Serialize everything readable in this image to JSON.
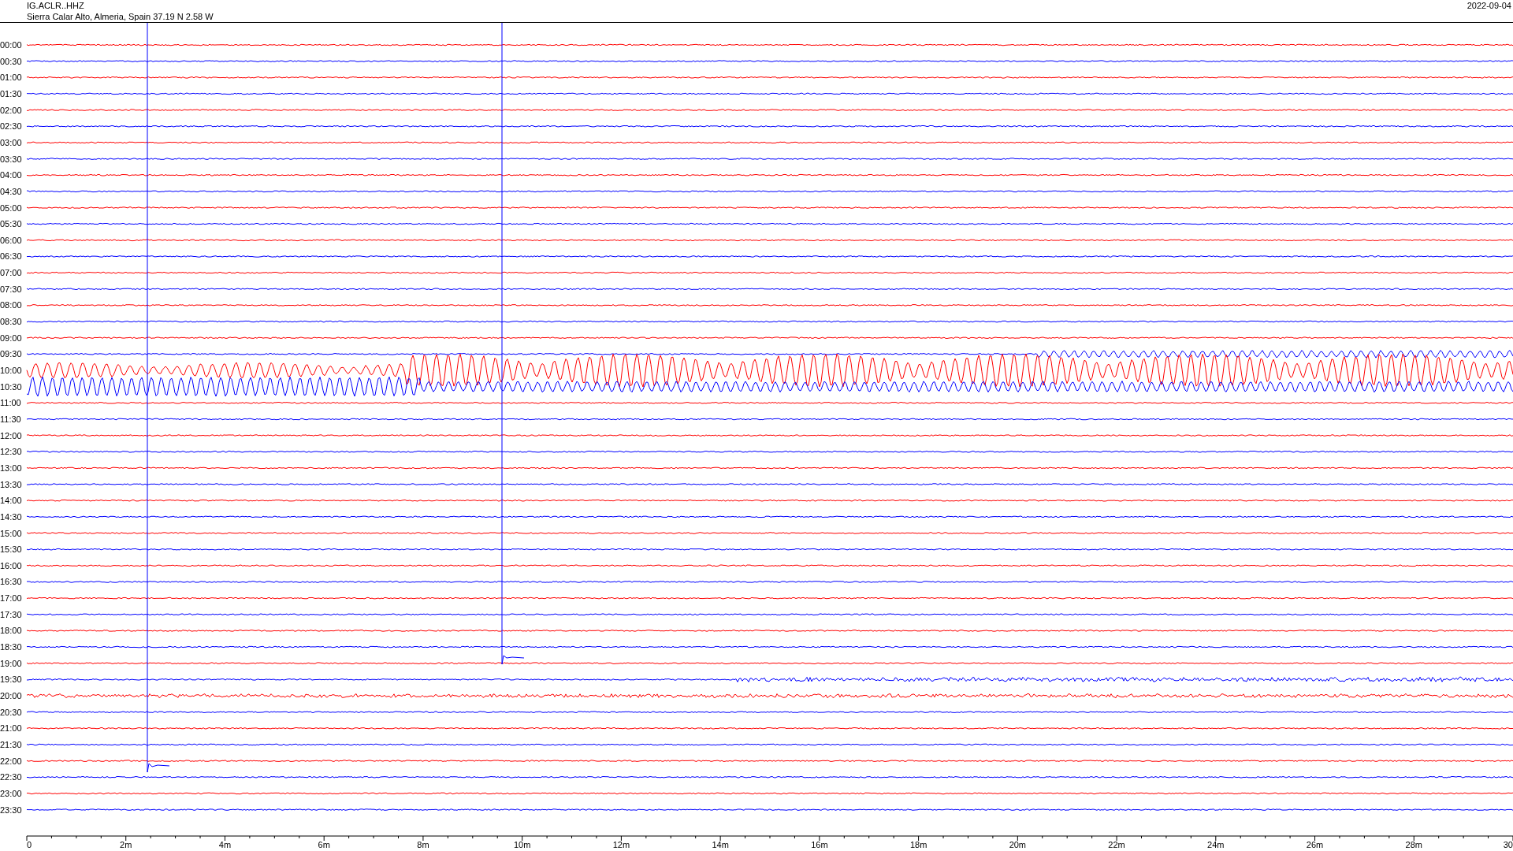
{
  "header": {
    "station": "IG.ACLR..HHZ",
    "location": "Sierra Calar Alto, Almeria, Spain  37.19 N 2.58 W",
    "date": "2022-09-04"
  },
  "rows": [
    {
      "label": "00:00",
      "color": "#ff0000"
    },
    {
      "label": "00:30",
      "color": "#0000ff"
    },
    {
      "label": "01:00",
      "color": "#ff0000"
    },
    {
      "label": "01:30",
      "color": "#0000ff"
    },
    {
      "label": "02:00",
      "color": "#ff0000"
    },
    {
      "label": "02:30",
      "color": "#0000ff"
    },
    {
      "label": "03:00",
      "color": "#ff0000"
    },
    {
      "label": "03:30",
      "color": "#0000ff"
    },
    {
      "label": "04:00",
      "color": "#ff0000"
    },
    {
      "label": "04:30",
      "color": "#0000ff"
    },
    {
      "label": "05:00",
      "color": "#ff0000"
    },
    {
      "label": "05:30",
      "color": "#0000ff"
    },
    {
      "label": "06:00",
      "color": "#ff0000"
    },
    {
      "label": "06:30",
      "color": "#0000ff"
    },
    {
      "label": "07:00",
      "color": "#ff0000"
    },
    {
      "label": "07:30",
      "color": "#0000ff"
    },
    {
      "label": "08:00",
      "color": "#ff0000"
    },
    {
      "label": "08:30",
      "color": "#0000ff"
    },
    {
      "label": "09:00",
      "color": "#ff0000"
    },
    {
      "label": "09:30",
      "color": "#0000ff"
    },
    {
      "label": "10:00",
      "color": "#ff0000"
    },
    {
      "label": "10:30",
      "color": "#0000ff"
    },
    {
      "label": "11:00",
      "color": "#ff0000"
    },
    {
      "label": "11:30",
      "color": "#0000ff"
    },
    {
      "label": "12:00",
      "color": "#ff0000"
    },
    {
      "label": "12:30",
      "color": "#0000ff"
    },
    {
      "label": "13:00",
      "color": "#ff0000"
    },
    {
      "label": "13:30",
      "color": "#0000ff"
    },
    {
      "label": "14:00",
      "color": "#ff0000"
    },
    {
      "label": "14:30",
      "color": "#0000ff"
    },
    {
      "label": "15:00",
      "color": "#ff0000"
    },
    {
      "label": "15:30",
      "color": "#0000ff"
    },
    {
      "label": "16:00",
      "color": "#ff0000"
    },
    {
      "label": "16:30",
      "color": "#0000ff"
    },
    {
      "label": "17:00",
      "color": "#ff0000"
    },
    {
      "label": "17:30",
      "color": "#0000ff"
    },
    {
      "label": "18:00",
      "color": "#ff0000"
    },
    {
      "label": "18:30",
      "color": "#0000ff"
    },
    {
      "label": "19:00",
      "color": "#ff0000"
    },
    {
      "label": "19:30",
      "color": "#0000ff"
    },
    {
      "label": "20:00",
      "color": "#ff0000"
    },
    {
      "label": "20:30",
      "color": "#0000ff"
    },
    {
      "label": "21:00",
      "color": "#ff0000"
    },
    {
      "label": "21:30",
      "color": "#0000ff"
    },
    {
      "label": "22:00",
      "color": "#ff0000"
    },
    {
      "label": "22:30",
      "color": "#0000ff"
    },
    {
      "label": "23:00",
      "color": "#ff0000"
    },
    {
      "label": "23:30",
      "color": "#0000ff"
    }
  ],
  "x_axis": {
    "ticks": [
      "0",
      "2m",
      "4m",
      "6m",
      "8m",
      "10m",
      "12m",
      "14m",
      "16m",
      "18m",
      "20m",
      "22m",
      "24m",
      "26m",
      "28m",
      "30"
    ]
  }
}
